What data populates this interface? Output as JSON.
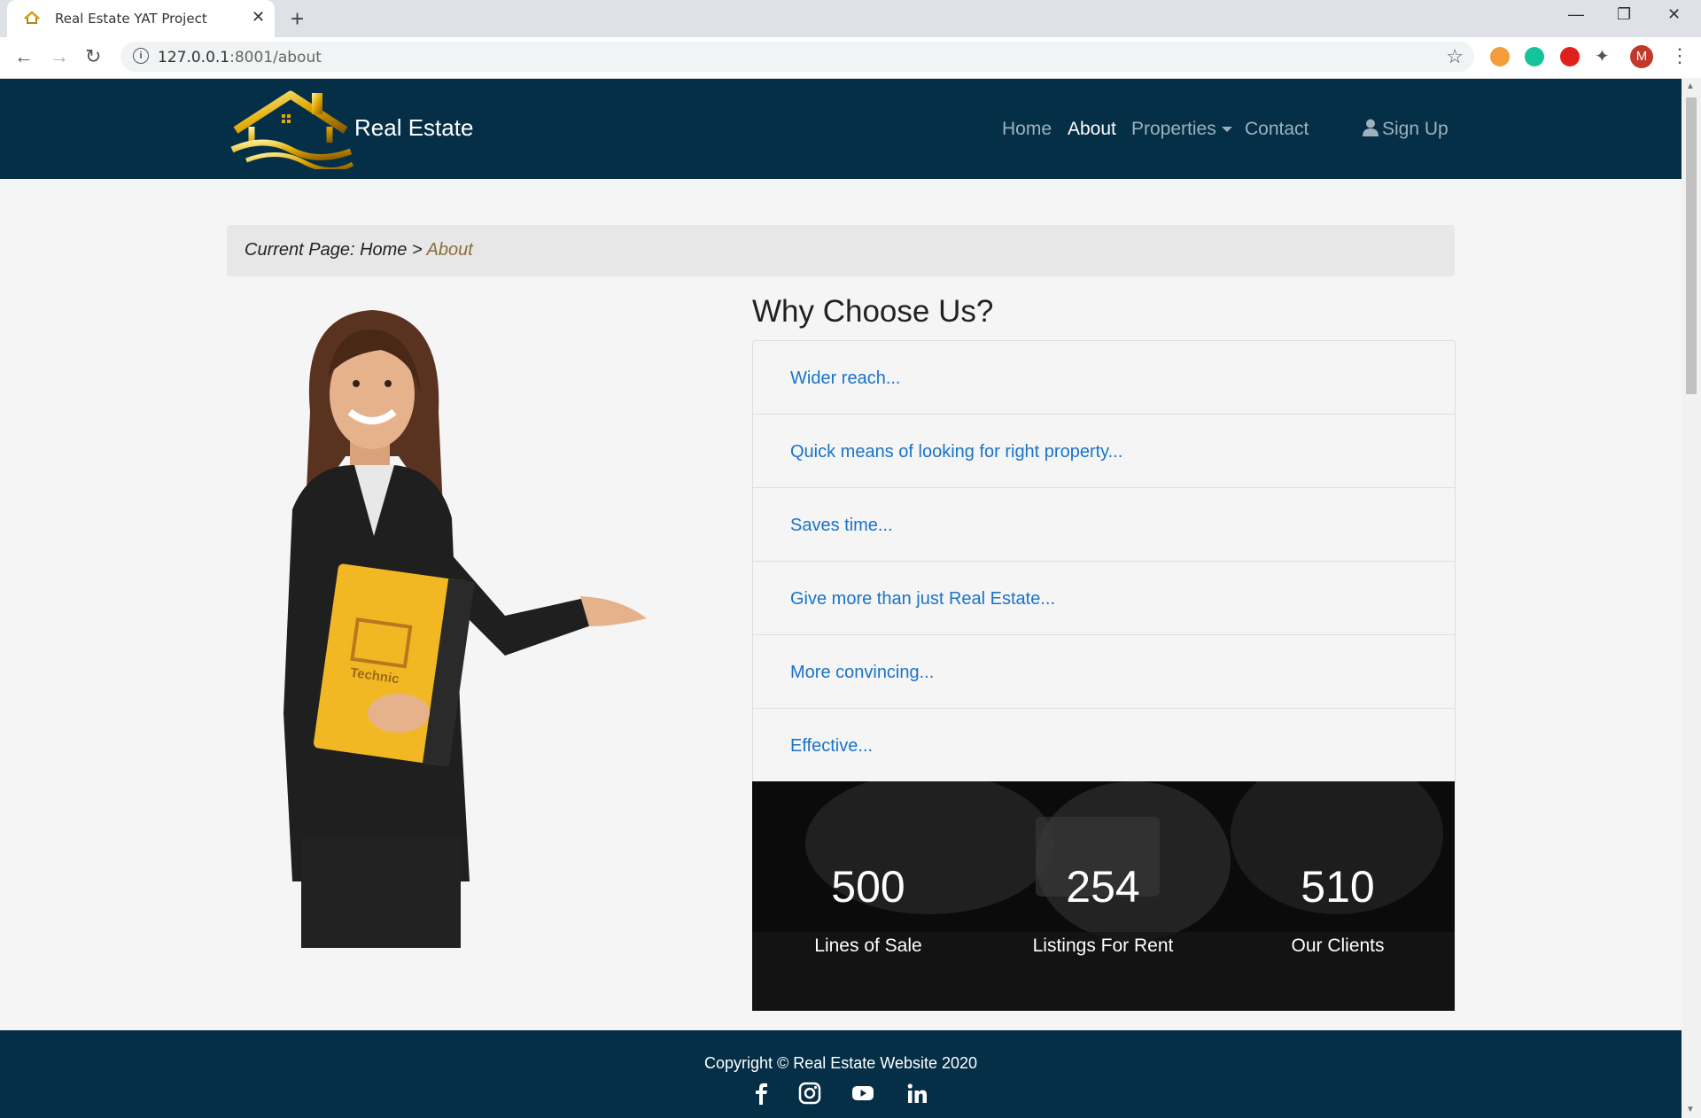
{
  "browser": {
    "tab_title": "Real Estate YAT Project",
    "url_host": "127.0.0.1",
    "url_rest": ":8001/about",
    "avatar_letter": "M"
  },
  "nav": {
    "brand": "Real Estate",
    "links": [
      "Home",
      "About",
      "Properties",
      "Contact"
    ],
    "active": "About",
    "signup": "Sign Up"
  },
  "breadcrumb": {
    "prefix": "Current Page: ",
    "home": "Home",
    "sep": " > ",
    "current": "About"
  },
  "why": {
    "title": "Why Choose Us?",
    "items": [
      "Wider reach...",
      "Quick means of looking for right property...",
      "Saves time...",
      "Give more than just Real Estate...",
      "More convincing...",
      "Effective..."
    ]
  },
  "stats": [
    {
      "value": "500",
      "label": "Lines of Sale"
    },
    {
      "value": "254",
      "label": "Listings For Rent"
    },
    {
      "value": "510",
      "label": "Our Clients"
    }
  ],
  "footer": {
    "copyright": "Copyright © Real Estate Website 2020",
    "social": [
      "facebook-icon",
      "instagram-icon",
      "youtube-icon",
      "linkedin-icon"
    ]
  },
  "colors": {
    "navbar": "#042f46",
    "link": "#1a73c8",
    "breadcrumb_active": "#8a6d3b"
  }
}
